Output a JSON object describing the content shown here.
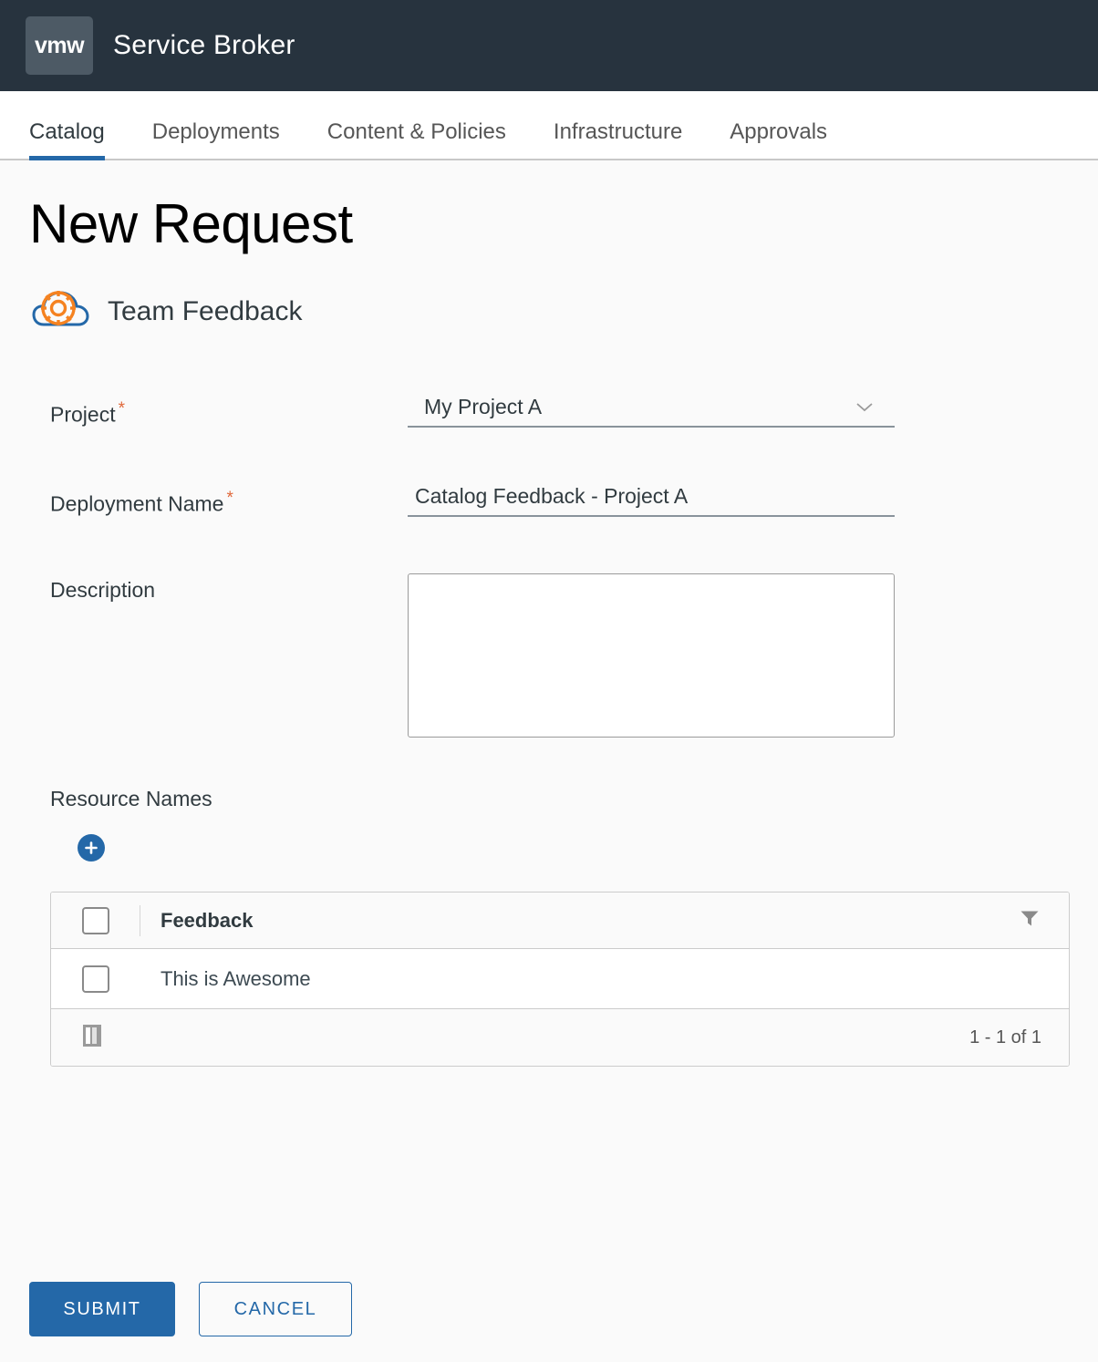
{
  "header": {
    "logo_text": "vmw",
    "app_title": "Service Broker"
  },
  "nav": {
    "tabs": [
      {
        "label": "Catalog",
        "active": true
      },
      {
        "label": "Deployments",
        "active": false
      },
      {
        "label": "Content & Policies",
        "active": false
      },
      {
        "label": "Infrastructure",
        "active": false
      },
      {
        "label": "Approvals",
        "active": false
      }
    ]
  },
  "page": {
    "title": "New Request",
    "catalog_item_name": "Team Feedback",
    "catalog_item_icon": "cloud-gear-icon"
  },
  "form": {
    "project": {
      "label": "Project",
      "required": true,
      "value": "My Project A",
      "icon": "chevron-down-icon"
    },
    "deployment_name": {
      "label": "Deployment Name",
      "required": true,
      "value": "Catalog Feedback - Project A",
      "placeholder": ""
    },
    "description": {
      "label": "Description",
      "required": false,
      "value": "",
      "placeholder": ""
    }
  },
  "resources": {
    "label": "Resource Names",
    "add_icon": "plus-circle-icon"
  },
  "table": {
    "columns": [
      "Feedback"
    ],
    "filter_icon": "filter-funnel-icon",
    "column_toggle_icon": "column-toggle-icon",
    "rows": [
      {
        "feedback": "This is Awesome"
      }
    ],
    "pagination": "1 - 1 of 1"
  },
  "actions": {
    "submit_label": "SUBMIT",
    "cancel_label": "CANCEL"
  },
  "colors": {
    "topbar_bg": "#27333e",
    "logo_bg": "#4d5a65",
    "accent_blue": "#2468a8",
    "required_star": "#e0683a",
    "icon_orange": "#f58220",
    "page_bg": "#fafafa"
  }
}
